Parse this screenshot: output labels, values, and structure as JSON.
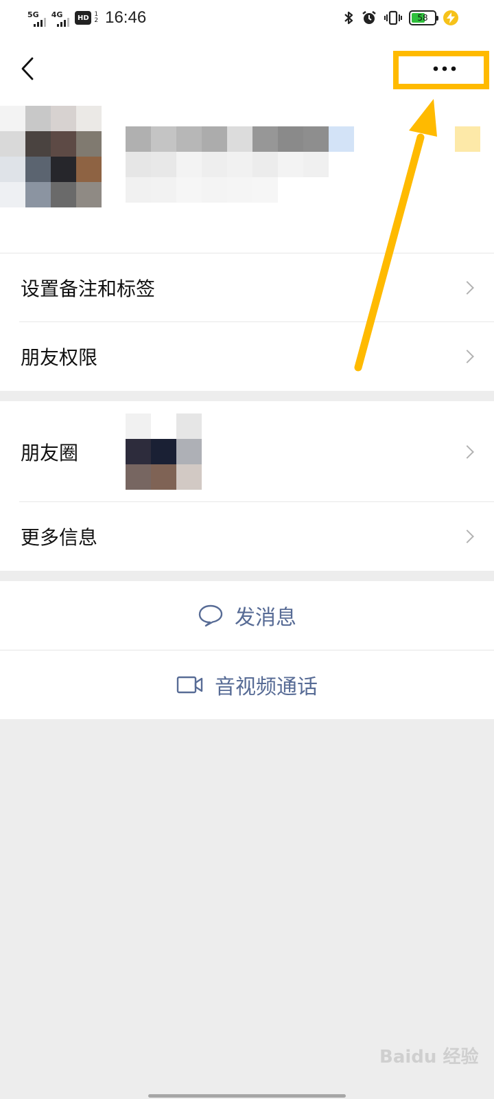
{
  "status_bar": {
    "network1": "5G",
    "network2": "4G",
    "hd_badge": "HD",
    "hd_sim_top": "1",
    "hd_sim_bottom": "2",
    "time": "16:46",
    "battery_percent": 58,
    "battery_text": "58",
    "icons": [
      "bluetooth-icon",
      "alarm-icon",
      "vibrate-icon",
      "battery-icon",
      "charging-icon"
    ]
  },
  "nav": {
    "back_icon": "chevron-left-icon",
    "more_icon": "more-dots-icon"
  },
  "profile": {
    "avatar_blurred": true,
    "name_blurred": true
  },
  "menu_group_1": [
    {
      "label": "设置备注和标签"
    },
    {
      "label": "朋友权限"
    }
  ],
  "menu_group_2": [
    {
      "label": "朋友圈"
    },
    {
      "label": "更多信息"
    }
  ],
  "actions": {
    "message": {
      "label": "发消息",
      "icon": "chat-bubble-icon"
    },
    "call": {
      "label": "音视频通话",
      "icon": "video-call-icon"
    }
  },
  "annotation": {
    "color": "#ffba00"
  },
  "colors": {
    "link": "#576b95",
    "page_bg": "#ededed"
  },
  "watermark": "Baidu 经验"
}
